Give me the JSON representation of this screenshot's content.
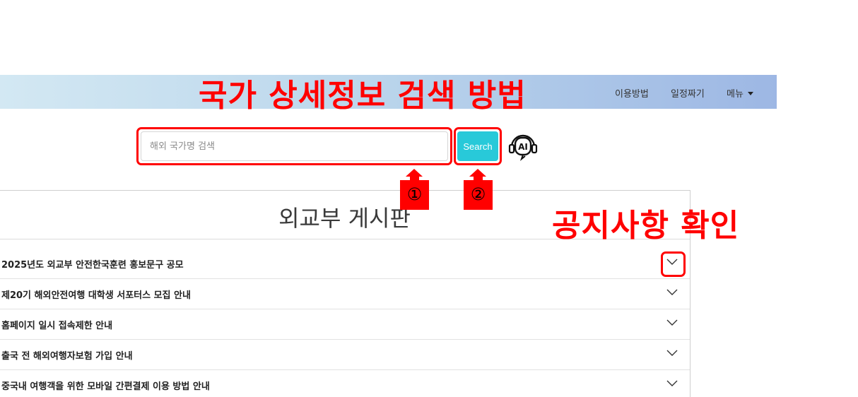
{
  "nav": {
    "items": [
      "이용방법",
      "일정짜기"
    ],
    "menu_label": "메뉴"
  },
  "annotations": {
    "title": "국가 상세정보 검색 방법",
    "notice": "공지사항 확인",
    "marker1": "①",
    "marker2": "②",
    "color": "#ff0000"
  },
  "search": {
    "placeholder": "해외 국가명 검색",
    "value": "",
    "button_label": "Search",
    "button_color": "#28c9d9",
    "ai_icon": "ai-headset-icon"
  },
  "board": {
    "title": "외교부 게시판",
    "items": [
      {
        "label": "2025년도 외교부 안전한국훈련 홍보문구 공모"
      },
      {
        "label": "제20기 해외안전여행 대학생 서포터스 모집 안내"
      },
      {
        "label": "홈페이지 일시 접속제한 안내"
      },
      {
        "label": "출국 전 해외여행자보험 가입 안내"
      },
      {
        "label": "중국내 여행객을 위한 모바일 간편결제 이용 방법 안내"
      }
    ],
    "expand_icon": "chevron-down-icon"
  }
}
